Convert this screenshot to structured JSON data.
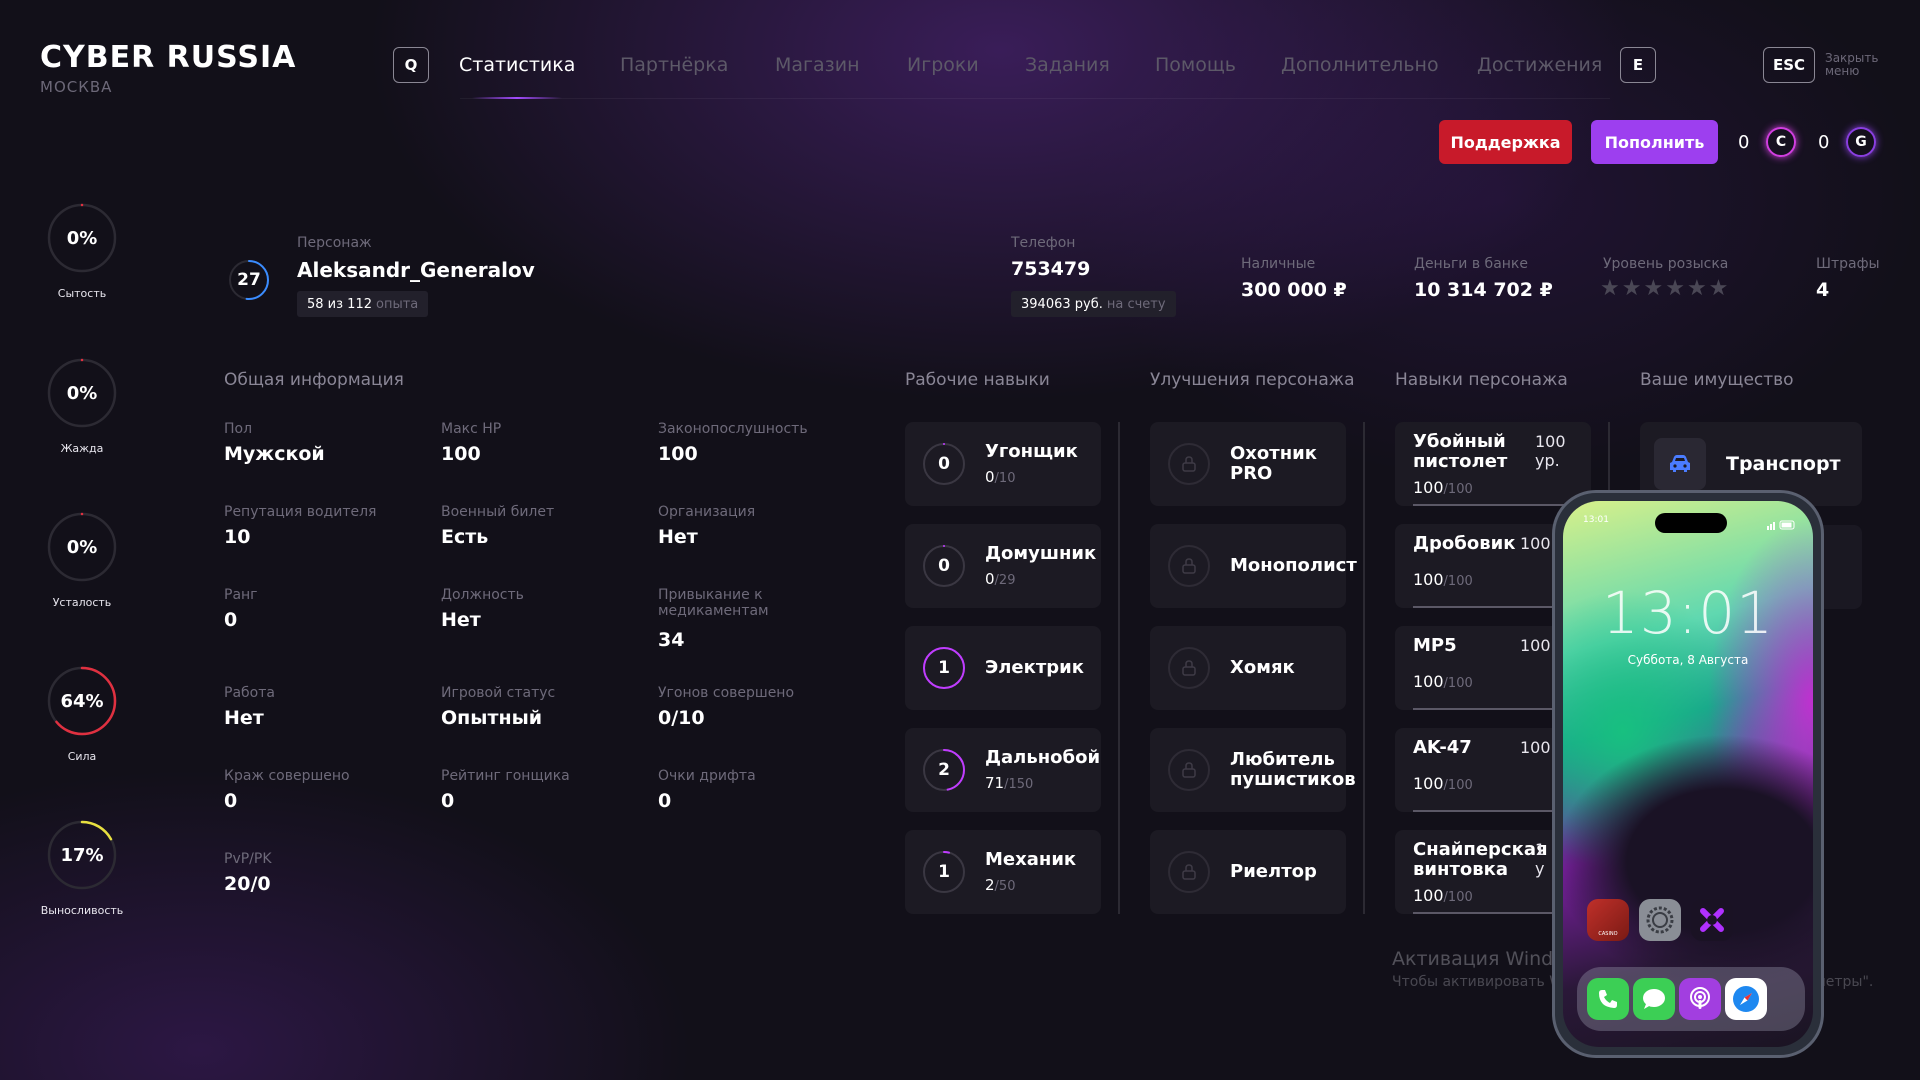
{
  "logo": {
    "title": "CYBER RUSSIA",
    "city": "МОСКВА"
  },
  "nav": {
    "left_key": "Q",
    "right_key": "E",
    "tabs": [
      "Статистика",
      "Партнёрка",
      "Магазин",
      "Игроки",
      "Задания",
      "Помощь",
      "Дополнительно",
      "Достижения"
    ],
    "active_tab": 0,
    "esc_key": "ESC",
    "esc_label_1": "Закрыть",
    "esc_label_2": "меню"
  },
  "actions": {
    "support": "Поддержка",
    "topup": "Пополнить",
    "currency_c_value": "0",
    "currency_c_icon": "C",
    "currency_g_value": "0",
    "currency_g_icon": "G"
  },
  "needs": [
    {
      "value": "0%",
      "label": "Сытость",
      "fraction": 0.0,
      "color": "#e03040"
    },
    {
      "value": "0%",
      "label": "Жажда",
      "fraction": 0.0,
      "color": "#e03040"
    },
    {
      "value": "0%",
      "label": "Усталость",
      "fraction": 0.0,
      "color": "#e03040"
    },
    {
      "value": "64%",
      "label": "Сила",
      "fraction": 0.64,
      "color": "#e03040"
    },
    {
      "value": "17%",
      "label": "Выносливость",
      "fraction": 0.17,
      "color": "#e8e040"
    }
  ],
  "character": {
    "level": "27",
    "level_fraction": 0.52,
    "label": "Персонаж",
    "name": "Aleksandr_Generalov",
    "exp_value": "58 из 112",
    "exp_unit": "опыта"
  },
  "phone": {
    "label": "Телефон",
    "number": "753479",
    "balance": "394063 руб.",
    "balance_suffix": "на счету"
  },
  "money": {
    "cash_label": "Наличные",
    "cash": "300 000 ₽",
    "bank_label": "Деньги в банке",
    "bank": "10 314 702 ₽",
    "wanted_label": "Уровень розыска",
    "wanted_stars": 0,
    "fines_label": "Штрафы",
    "fines": "4"
  },
  "general": {
    "title": "Общая информация",
    "rows": [
      [
        {
          "label": "Пол",
          "value": "Мужской"
        },
        {
          "label": "Макс HP",
          "value": "100"
        },
        {
          "label": "Законопослушность",
          "value": "100"
        }
      ],
      [
        {
          "label": "Репутация водителя",
          "value": "10"
        },
        {
          "label": "Военный билет",
          "value": "Есть"
        },
        {
          "label": "Организация",
          "value": "Нет"
        }
      ],
      [
        {
          "label": "Ранг",
          "value": "0"
        },
        {
          "label": "Должность",
          "value": "Нет"
        },
        {
          "label": "Привыкание к медикаментам",
          "value": "34"
        }
      ],
      [
        {
          "label": "Работа",
          "value": "Нет"
        },
        {
          "label": "Игровой статус",
          "value": "Опытный"
        },
        {
          "label": "Угонов совершено",
          "value": "0/10"
        }
      ],
      [
        {
          "label": "Краж совершено",
          "value": "0"
        },
        {
          "label": "Рейтинг гонщика",
          "value": "0"
        },
        {
          "label": "Очки дрифта",
          "value": "0"
        }
      ],
      [
        {
          "label": "PvP/PK",
          "value": "20/0"
        }
      ]
    ]
  },
  "work_skills": {
    "title": "Рабочие навыки",
    "items": [
      {
        "level": "0",
        "name": "Угонщик",
        "progress": "0",
        "max": "/10",
        "fraction": 0.0
      },
      {
        "level": "0",
        "name": "Домушник",
        "progress": "0",
        "max": "/29",
        "fraction": 0.0
      },
      {
        "level": "1",
        "name": "Электрик",
        "progress": "",
        "max": "",
        "fraction": 1.0
      },
      {
        "level": "2",
        "name": "Дальнобой",
        "progress": "71",
        "max": "/150",
        "fraction": 0.47
      },
      {
        "level": "1",
        "name": "Механик",
        "progress": "2",
        "max": "/50",
        "fraction": 0.04
      }
    ]
  },
  "upgrades": {
    "title": "Улучшения персонажа",
    "items": [
      {
        "name_1": "Охотник",
        "name_2": "PRO"
      },
      {
        "name_1": "Монополист",
        "name_2": ""
      },
      {
        "name_1": "Хомяк",
        "name_2": ""
      },
      {
        "name_1": "Любитель",
        "name_2": "пушистиков"
      },
      {
        "name_1": "Риелтор",
        "name_2": ""
      }
    ]
  },
  "char_skills": {
    "title": "Навыки персонажа",
    "items": [
      {
        "name_1": "Убойный",
        "name_2": "пистолет",
        "lvl_1": "100",
        "lvl_2": "ур.",
        "value": "100",
        "max": "/100"
      },
      {
        "name_1": "Дробовик",
        "name_2": "",
        "lvl_1": "100",
        "lvl_2": "",
        "value": "100",
        "max": "/100"
      },
      {
        "name_1": "MP5",
        "name_2": "",
        "lvl_1": "100",
        "lvl_2": "",
        "value": "100",
        "max": "/100"
      },
      {
        "name_1": "AK-47",
        "name_2": "",
        "lvl_1": "100",
        "lvl_2": "",
        "value": "100",
        "max": "/100"
      },
      {
        "name_1": "Снайперская",
        "name_2": "винтовка",
        "lvl_1": "1",
        "lvl_2": "у",
        "value": "100",
        "max": "/100"
      }
    ]
  },
  "property": {
    "title": "Ваше имущество",
    "items": [
      {
        "name": "Транспорт",
        "icon": "car-icon"
      }
    ]
  },
  "windows": {
    "line1": "Активация Windows",
    "line2": "Чтобы активировать Windows",
    "line2_tail": "раметры\"."
  },
  "smartphone": {
    "status_time": "13:01",
    "time": "13:01",
    "date": "Суббота, 8 Августа",
    "app_badge": "CASINO"
  },
  "colors": {
    "accent": "#9d3fef",
    "danger": "#c81a2a",
    "coin_c": "#d13fe0",
    "coin_g": "#8a3fe0"
  }
}
